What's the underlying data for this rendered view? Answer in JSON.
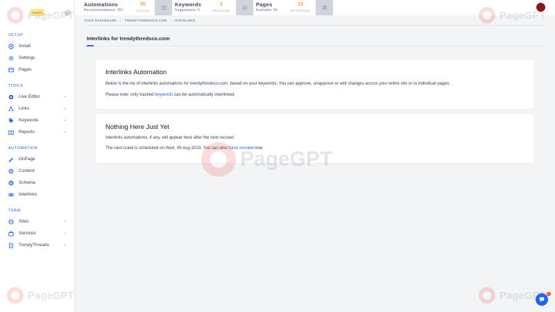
{
  "logo": {
    "text": "PageGPT"
  },
  "topbar": {
    "automations": {
      "name": "Automations",
      "sub_label": "Recommendations:",
      "sub_value": "357",
      "count": "95",
      "count_label": "ACTIVE"
    },
    "keywords": {
      "name": "Keywords",
      "sub_label": "Suggestions:",
      "sub_value": "6",
      "count": "2",
      "count_label": "TRACKING"
    },
    "pages": {
      "name": "Pages",
      "sub_label": "Available:",
      "sub_value": "54",
      "count": "19",
      "count_label": "OPTIMIZED"
    }
  },
  "sidebar": {
    "setup_label": "SETUP",
    "setup": [
      {
        "label": "Install",
        "icon": "install-icon"
      },
      {
        "label": "Settings",
        "icon": "gear-icon"
      },
      {
        "label": "Pages",
        "icon": "pages-icon"
      }
    ],
    "tools_label": "TOOLS",
    "tools": [
      {
        "label": "Live Editor",
        "icon": "live-editor-icon"
      },
      {
        "label": "Links",
        "icon": "links-icon"
      },
      {
        "label": "Keywords",
        "icon": "keywords-icon"
      },
      {
        "label": "Reports",
        "icon": "reports-icon"
      }
    ],
    "automation_label": "AUTOMATION",
    "automation": [
      {
        "label": "OnPage",
        "icon": "onpage-icon"
      },
      {
        "label": "Content",
        "icon": "content-icon"
      },
      {
        "label": "Schema",
        "icon": "schema-icon"
      },
      {
        "label": "Interlinks",
        "icon": "interlinks-icon"
      }
    ],
    "team_label": "TEAM",
    "team": [
      {
        "label": "Sites",
        "icon": "sites-icon"
      },
      {
        "label": "Services",
        "icon": "services-icon"
      },
      {
        "label": "TrendyThreads",
        "icon": "user-icon"
      }
    ]
  },
  "breadcrumb": {
    "items": [
      "YOUR DASHBOARD",
      "TRENDYTHREDSCO.COM",
      "INTERLINKS"
    ],
    "separator": "/"
  },
  "page_title": "Interlinks for trendythredsco.com",
  "card_automation": {
    "title": "Interlinks Automation",
    "description": "Below is the list of interlinks automations for trendythredsco.com, based on your keywords. You can approve, unapprove or edit changes across your entire site or to individual pages.",
    "note_prefix": "Please note: only tracked ",
    "note_link": "keywords",
    "note_suffix": " can be automatically interlinked."
  },
  "card_empty": {
    "title": "Nothing Here Just Yet",
    "line1": "Interlinks automations, if any, will appear here after the next recrawl.",
    "line2_prefix": "The next crawl is scheduled on Wed, 09 Aug 2023. You can also ",
    "line2_link": "force recrawl",
    "line2_suffix": " now."
  },
  "watermark": {
    "text": "PageGPT"
  },
  "help": {
    "badge": "1"
  },
  "colors": {
    "accent": "#2563eb",
    "stat_count": "#d97706",
    "avatar": "#7f1d1d"
  }
}
